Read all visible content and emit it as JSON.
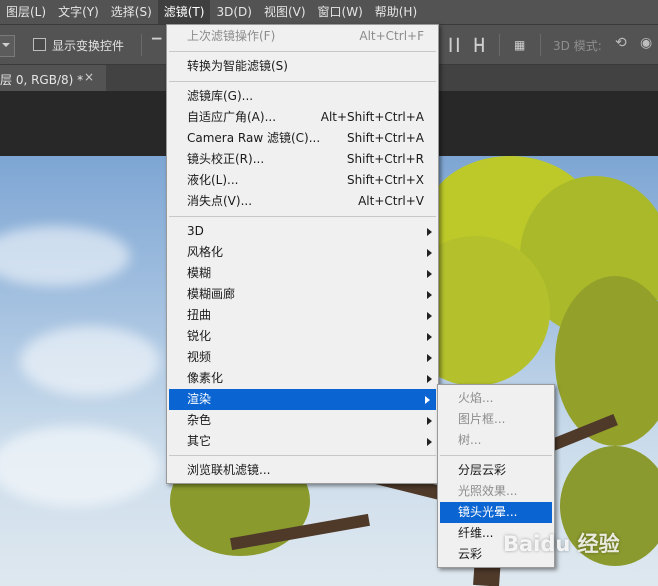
{
  "menubar": {
    "items": [
      {
        "label": "图层(L)"
      },
      {
        "label": "文字(Y)"
      },
      {
        "label": "选择(S)"
      },
      {
        "label": "滤镜(T)"
      },
      {
        "label": "3D(D)"
      },
      {
        "label": "视图(V)"
      },
      {
        "label": "窗口(W)"
      },
      {
        "label": "帮助(H)"
      }
    ]
  },
  "options_bar": {
    "show_transform_label": "显示变换控件",
    "mode_3d_label": "3D 模式:"
  },
  "document_tab": {
    "title": "层 0, RGB/8) *",
    "close_glyph": "×"
  },
  "filter_menu": {
    "items": [
      {
        "label": "上次滤镜操作(F)",
        "shortcut": "Alt+Ctrl+F"
      },
      {
        "label": "转换为智能滤镜(S)",
        "shortcut": ""
      },
      {
        "label": "滤镜库(G)...",
        "shortcut": ""
      },
      {
        "label": "自适应广角(A)...",
        "shortcut": "Alt+Shift+Ctrl+A"
      },
      {
        "label": "Camera Raw 滤镜(C)...",
        "shortcut": "Shift+Ctrl+A"
      },
      {
        "label": "镜头校正(R)...",
        "shortcut": "Shift+Ctrl+R"
      },
      {
        "label": "液化(L)...",
        "shortcut": "Shift+Ctrl+X"
      },
      {
        "label": "消失点(V)...",
        "shortcut": "Alt+Ctrl+V"
      },
      {
        "label": "3D"
      },
      {
        "label": "风格化"
      },
      {
        "label": "模糊"
      },
      {
        "label": "模糊画廊"
      },
      {
        "label": "扭曲"
      },
      {
        "label": "锐化"
      },
      {
        "label": "视频"
      },
      {
        "label": "像素化"
      },
      {
        "label": "渲染"
      },
      {
        "label": "杂色"
      },
      {
        "label": "其它"
      },
      {
        "label": "浏览联机滤镜..."
      }
    ]
  },
  "render_submenu": {
    "items": [
      {
        "label": "火焰..."
      },
      {
        "label": "图片框..."
      },
      {
        "label": "树..."
      },
      {
        "label": "分层云彩"
      },
      {
        "label": "光照效果..."
      },
      {
        "label": "镜头光晕..."
      },
      {
        "label": "纤维..."
      },
      {
        "label": "云彩"
      }
    ]
  },
  "watermark": "Baidu 经验",
  "colors": {
    "menu_highlight": "#0a64d2",
    "menubar_bg": "#535353",
    "menu_bg": "#f0f0f0"
  }
}
